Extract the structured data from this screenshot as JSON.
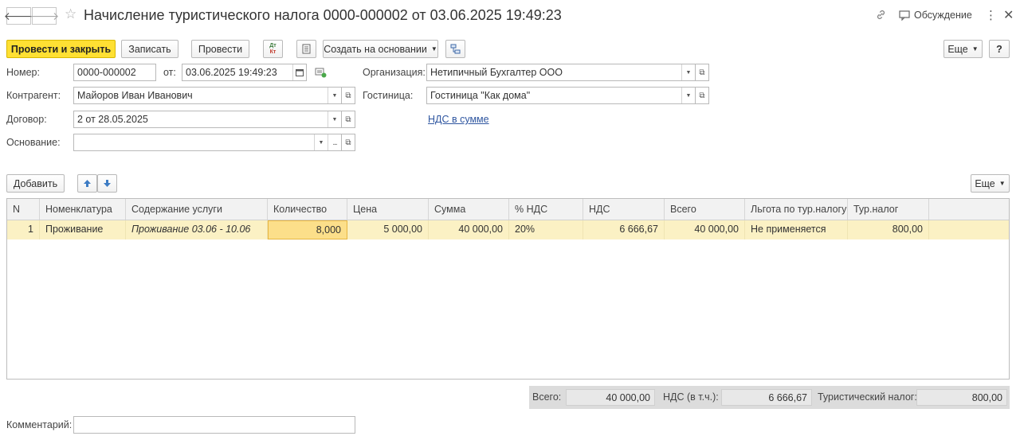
{
  "header": {
    "title": "Начисление туристического налога 0000-000002 от 03.06.2025 19:49:23",
    "discussion": "Обсуждение"
  },
  "toolbar": {
    "post_close": "Провести и закрыть",
    "save": "Записать",
    "post": "Провести",
    "dtkt_top": "Дт",
    "dtkt_bottom": "Кт",
    "create_based": "Создать на основании",
    "more": "Еще",
    "help": "?"
  },
  "form": {
    "number_label": "Номер:",
    "number": "0000-000002",
    "date_label": "от:",
    "date": "03.06.2025 19:49:23",
    "counterparty_label": "Контрагент:",
    "counterparty": "Майоров Иван Иванович",
    "contract_label": "Договор:",
    "contract": "2 от 28.05.2025",
    "basis_label": "Основание:",
    "basis": "",
    "organization_label": "Организация:",
    "organization": "Нетипичный Бухгалтер ООО",
    "hotel_label": "Гостиница:",
    "hotel": "Гостиница \"Как дома\"",
    "vat_link": "НДС в сумме"
  },
  "table_toolbar": {
    "add": "Добавить",
    "more": "Еще"
  },
  "table": {
    "columns": [
      "N",
      "Номенклатура",
      "Содержание услуги",
      "Количество",
      "Цена",
      "Сумма",
      "% НДС",
      "НДС",
      "Всего",
      "Льгота по тур.налогу",
      "Тур.налог"
    ],
    "rows": [
      [
        "1",
        "Проживание",
        "Проживание 03.06 - 10.06",
        "8,000",
        "5 000,00",
        "40 000,00",
        "20%",
        "6 666,67",
        "40 000,00",
        "Не применяется",
        "800,00"
      ]
    ]
  },
  "totals": {
    "total_label": "Всего:",
    "total": "40 000,00",
    "vat_label": "НДС (в т.ч.):",
    "vat": "6 666,67",
    "tax_label": "Туристический налог:",
    "tax": "800,00"
  },
  "comment": {
    "label": "Комментарий:",
    "value": ""
  }
}
